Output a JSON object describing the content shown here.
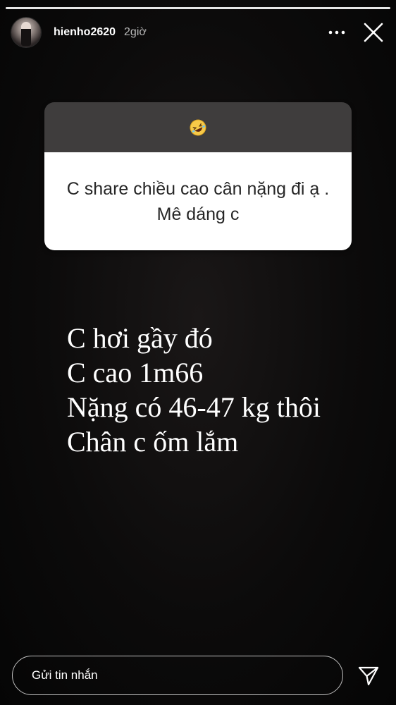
{
  "story": {
    "progress": 1.0
  },
  "header": {
    "username": "hienho2620",
    "time": "2giờ",
    "more_icon": "more-horizontal-icon",
    "close_icon": "close-icon"
  },
  "question_sticker": {
    "emoji": "🤣",
    "question": "C share chiều cao cân nặng đi ạ . Mê dáng c"
  },
  "answer_lines": [
    "C hơi gầy đó",
    "C cao 1m66",
    "Nặng có 46-47 kg thôi",
    "Chân c ốm lắm"
  ],
  "footer": {
    "message_placeholder": "Gửi tin nhắn",
    "send_icon": "send-icon"
  },
  "colors": {
    "background": "#060606",
    "card_header": "#3f3d3d",
    "card_body": "#ffffff",
    "text_primary": "#ffffff"
  }
}
